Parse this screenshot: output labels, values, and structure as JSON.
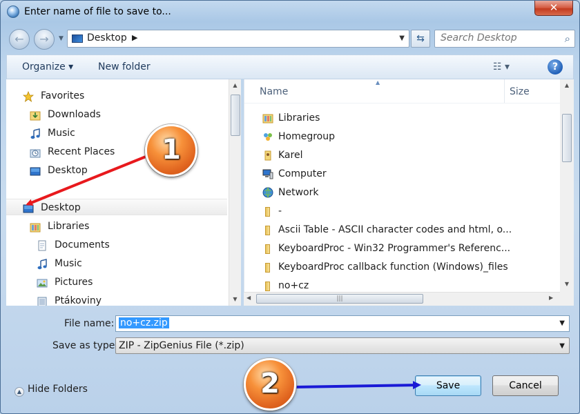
{
  "window": {
    "title": "Enter name of file to save to...",
    "close_glyph": "✕"
  },
  "nav": {
    "back_glyph": "←",
    "forward_glyph": "→",
    "address": "Desktop",
    "address_sep": "▶",
    "refresh_glyph": "⇆",
    "search_placeholder": "Search Desktop"
  },
  "toolbar": {
    "organize": "Organize ▾",
    "new_folder": "New folder",
    "view_glyph": "☷ ▾",
    "help_glyph": "?"
  },
  "sidebar": {
    "items": [
      {
        "label": "Favorites",
        "icon": "star-icon"
      },
      {
        "label": "Downloads",
        "icon": "downloads-folder-icon"
      },
      {
        "label": "Music",
        "icon": "music-icon"
      },
      {
        "label": "Recent Places",
        "icon": "recent-places-icon"
      },
      {
        "label": "Desktop",
        "icon": "desktop-icon"
      },
      {
        "label": "Desktop",
        "icon": "desktop-icon",
        "selected": true
      },
      {
        "label": "Libraries",
        "icon": "libraries-icon"
      },
      {
        "label": "Documents",
        "icon": "documents-icon"
      },
      {
        "label": "Music",
        "icon": "music-icon"
      },
      {
        "label": "Pictures",
        "icon": "pictures-icon"
      },
      {
        "label": "Ptákoviny",
        "icon": "library-icon"
      }
    ]
  },
  "columns": {
    "name": "Name",
    "size": "Size"
  },
  "files": [
    {
      "label": "Libraries",
      "icon": "libraries-icon"
    },
    {
      "label": "Homegroup",
      "icon": "homegroup-icon"
    },
    {
      "label": "Karel",
      "icon": "user-folder-icon"
    },
    {
      "label": "Computer",
      "icon": "computer-icon"
    },
    {
      "label": "Network",
      "icon": "network-icon"
    },
    {
      "label": "-",
      "icon": "folder-icon"
    },
    {
      "label": "Ascii Table - ASCII character codes and html, o...",
      "icon": "folder-icon"
    },
    {
      "label": "KeyboardProc - Win32 Programmer's Referenc...",
      "icon": "folder-icon"
    },
    {
      "label": "KeyboardProc callback function (Windows)_files",
      "icon": "folder-icon"
    },
    {
      "label": "no+cz",
      "icon": "folder-icon"
    }
  ],
  "form": {
    "file_name_label": "File name:",
    "file_name_value": "no+cz.zip",
    "save_as_type_label": "Save as type:",
    "save_as_type_value": "ZIP - ZipGenius File (*.zip)"
  },
  "footer": {
    "hide_folders": "Hide Folders",
    "save": "Save",
    "cancel": "Cancel"
  },
  "annotations": {
    "badge1": "1",
    "badge2": "2",
    "arrow_color_1": "#e8191d",
    "arrow_color_2": "#1a1ad6"
  }
}
